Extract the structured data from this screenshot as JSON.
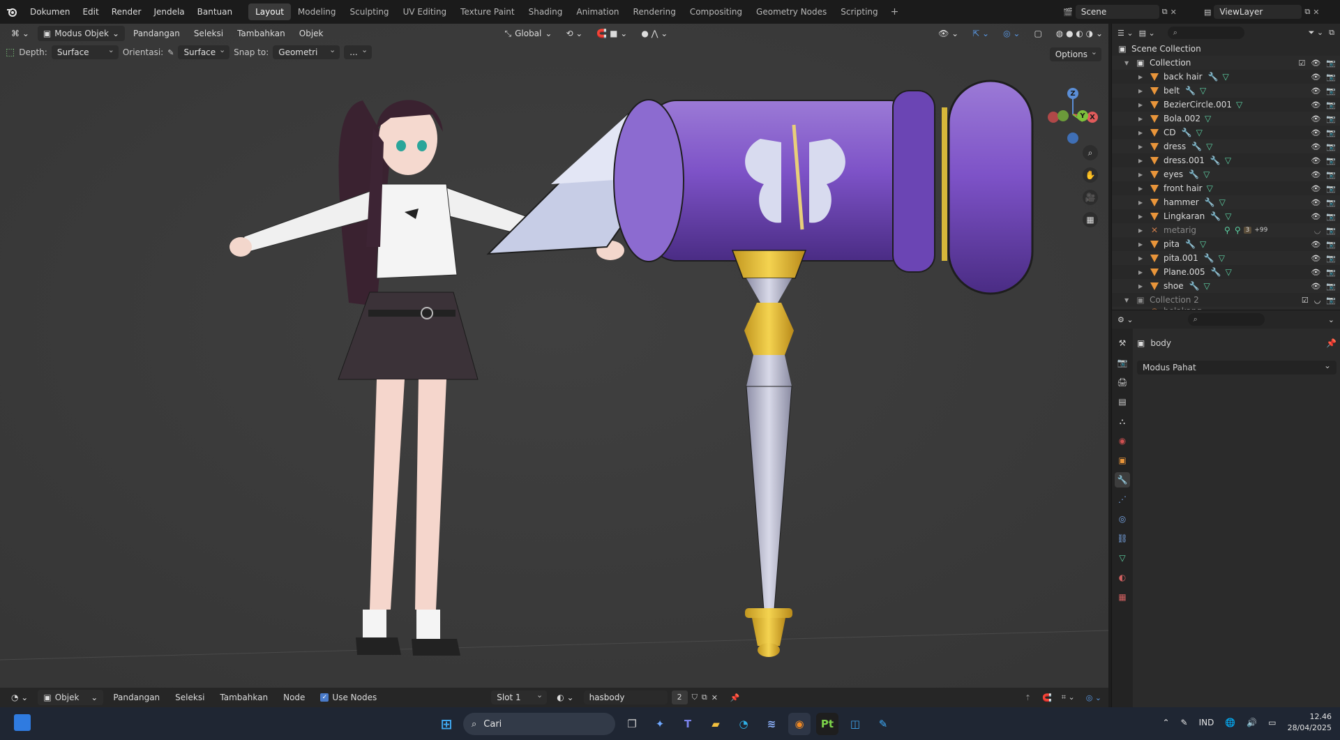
{
  "menu": {
    "items": [
      "Dokumen",
      "Edit",
      "Render",
      "Jendela",
      "Bantuan"
    ],
    "workspaces": [
      "Layout",
      "Modeling",
      "Sculpting",
      "UV Editing",
      "Texture Paint",
      "Shading",
      "Animation",
      "Rendering",
      "Compositing",
      "Geometry Nodes",
      "Scripting"
    ],
    "active_workspace": "Layout",
    "scene": "Scene",
    "view_layer": "ViewLayer"
  },
  "viewport": {
    "mode": "Modus Objek",
    "menus": [
      "Pandangan",
      "Seleksi",
      "Tambahkan",
      "Objek"
    ],
    "transform": "Global",
    "depth_label": "Depth:",
    "depth_value": "Surface",
    "orient_label": "Orientasi:",
    "orient_value": "Surface",
    "snap_label": "Snap to:",
    "snap_value": "Geometri",
    "more": "...",
    "options": "Options",
    "axis_z": "Z",
    "axis_y": "Y",
    "axis_x": "X"
  },
  "shader_header": {
    "mode": "Objek",
    "menus": [
      "Pandangan",
      "Seleksi",
      "Tambahkan",
      "Node"
    ],
    "use_nodes": "Use Nodes",
    "slot": "Slot 1",
    "material": "hasbody",
    "users": "2"
  },
  "outliner": {
    "root": "Scene Collection",
    "collection": "Collection",
    "items": [
      {
        "name": "back hair"
      },
      {
        "name": "belt"
      },
      {
        "name": "BezierCircle.001"
      },
      {
        "name": "Bola.002"
      },
      {
        "name": "CD"
      },
      {
        "name": "dress"
      },
      {
        "name": "dress.001"
      },
      {
        "name": "eyes"
      },
      {
        "name": "front hair"
      },
      {
        "name": "hammer"
      },
      {
        "name": "Lingkaran"
      },
      {
        "name": "metarig",
        "badge": "3",
        "extra": "+99"
      },
      {
        "name": "pita"
      },
      {
        "name": "pita.001"
      },
      {
        "name": "Plane.005"
      },
      {
        "name": "shoe"
      }
    ],
    "collection2": "Collection 2",
    "partial_item": "belakang"
  },
  "properties": {
    "object_name": "body",
    "mode_select": "Modus Pahat"
  },
  "taskbar": {
    "search": "Cari",
    "lang": "IND",
    "time": "12.46",
    "date": "28/04/2025",
    "pt_label": "Pt"
  },
  "colors": {
    "accent": "#4a7bc9",
    "object_orange": "#e9953a",
    "mesh_green": "#5ed3a5",
    "modifier_blue": "#7aa8e8",
    "hammer_purple": "#7a4fc0",
    "gold": "#e8c43a"
  }
}
